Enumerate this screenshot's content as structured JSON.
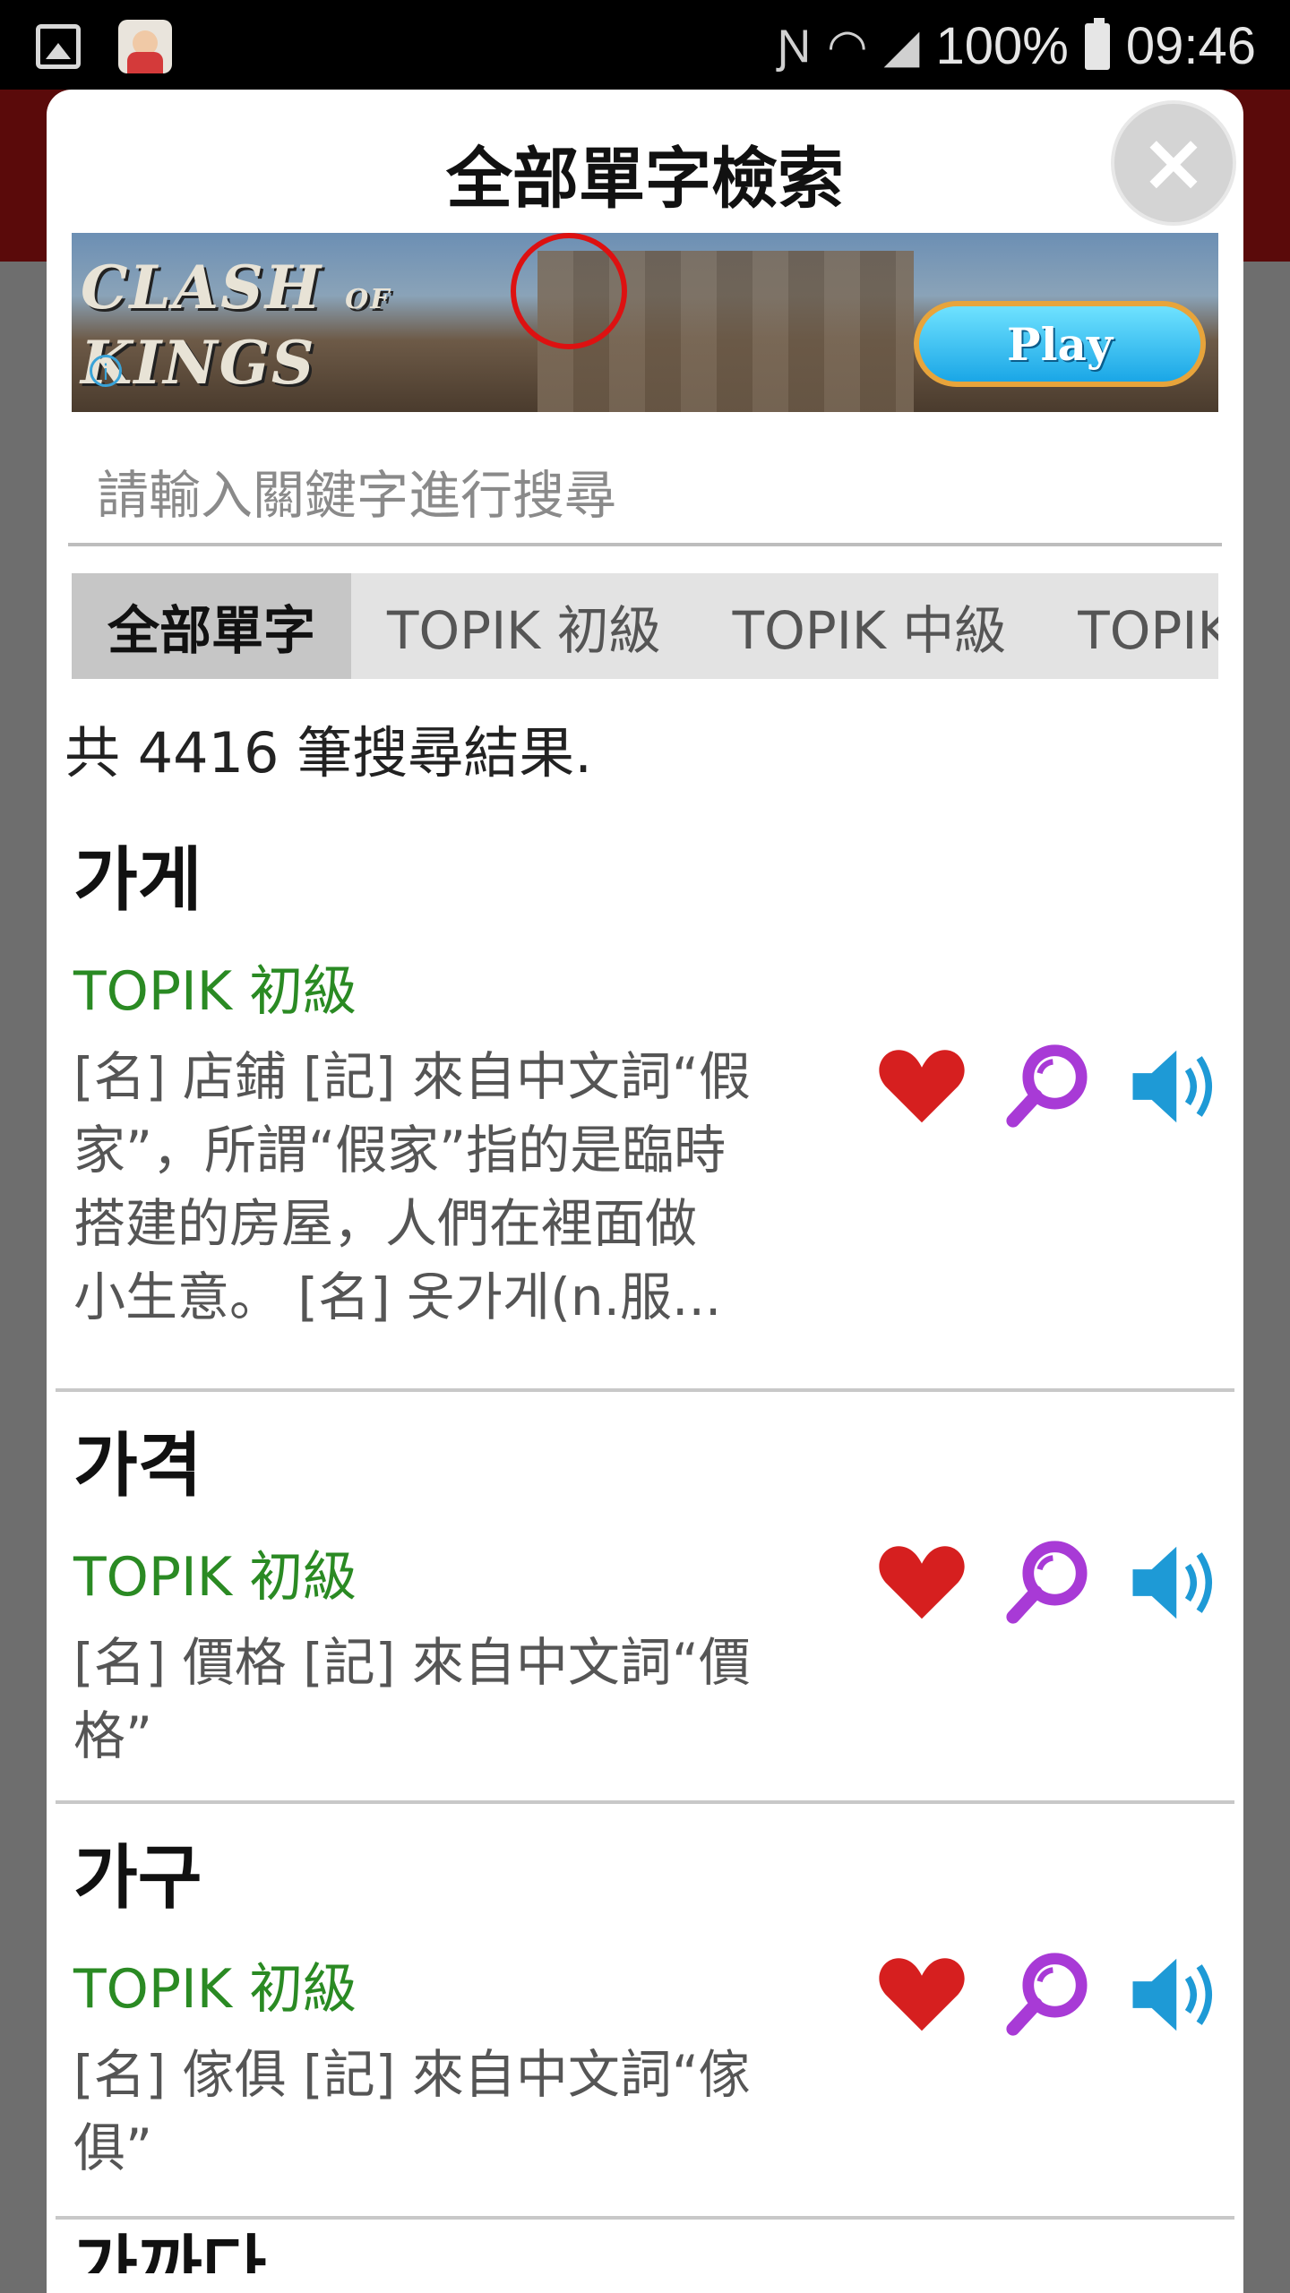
{
  "status_bar": {
    "battery_text": "100%",
    "time": "09:46",
    "icons": [
      "gallery-icon",
      "app-icon",
      "nfc-icon",
      "wifi-icon",
      "signal-icon",
      "battery-icon"
    ]
  },
  "dialog": {
    "title": "全部單字檢索",
    "close_label": "×"
  },
  "ad": {
    "logo_line1": "CLASH",
    "logo_of": "OF",
    "logo_line2": "KINGS",
    "play_label": "Play",
    "info_label": "i"
  },
  "search": {
    "placeholder": "請輸入關鍵字進行搜尋",
    "value": ""
  },
  "tabs": [
    {
      "label": "全部單字",
      "active": true
    },
    {
      "label": "TOPIK 初級",
      "active": false
    },
    {
      "label": "TOPIK 中級",
      "active": false
    },
    {
      "label": "TOPIK 高級",
      "active": false
    }
  ],
  "result_count": "共 4416 筆搜尋結果.",
  "results": [
    {
      "word": "가게",
      "level": "TOPIK 初級",
      "definition_lines": [
        "[名] 店鋪 [記] 來自中文詞“假",
        "家”，所謂“假家”指的是臨時",
        "搭建的房屋，人們在裡面做",
        "小生意。 [名] 옷가게(n.服..."
      ]
    },
    {
      "word": "가격",
      "level": "TOPIK 初級",
      "definition_lines": [
        "[名] 價格 [記] 來自中文詞“價",
        "格”"
      ]
    },
    {
      "word": "가구",
      "level": "TOPIK 初級",
      "definition_lines": [
        "[名] 傢俱 [記] 來自中文詞“傢",
        "俱”"
      ]
    }
  ],
  "partial_next_word": "가까다",
  "colors": {
    "level_green": "#2a8a23",
    "heart_red": "#d61f1f",
    "magnifier_purple": "#a83ad6",
    "speaker_blue": "#1e9ad6"
  }
}
